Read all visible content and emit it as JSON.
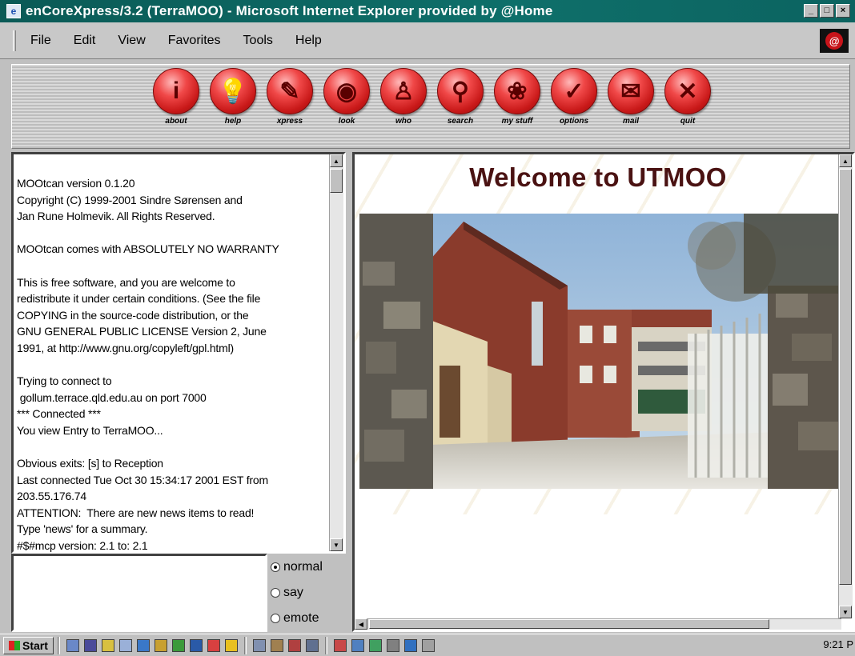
{
  "window": {
    "title": "enCoreXpress/3.2 (TerraMOO) - Microsoft Internet Explorer provided by @Home",
    "controls": [
      "_",
      "□",
      "×"
    ]
  },
  "menu": {
    "items": [
      "File",
      "Edit",
      "View",
      "Favorites",
      "Tools",
      "Help"
    ]
  },
  "toolbar": {
    "buttons": [
      {
        "label": "about",
        "icon": "info-icon",
        "glyph": "i"
      },
      {
        "label": "help",
        "icon": "lightbulb-icon",
        "glyph": "💡"
      },
      {
        "label": "xpress",
        "icon": "pencil-icon",
        "glyph": "✎"
      },
      {
        "label": "look",
        "icon": "eye-icon",
        "glyph": "◉"
      },
      {
        "label": "who",
        "icon": "person-icon",
        "glyph": "♙"
      },
      {
        "label": "search",
        "icon": "magnifier-icon",
        "glyph": "⚲"
      },
      {
        "label": "my stuff",
        "icon": "bag-icon",
        "glyph": "❀"
      },
      {
        "label": "options",
        "icon": "checkmark-icon",
        "glyph": "✓"
      },
      {
        "label": "mail",
        "icon": "envelope-icon",
        "glyph": "✉"
      },
      {
        "label": "quit",
        "icon": "close-icon",
        "glyph": "✕"
      }
    ]
  },
  "console": {
    "text": "MOOtcan version 0.1.20\nCopyright (C) 1999-2001 Sindre Sørensen and\nJan Rune Holmevik. All Rights Reserved.\n\nMOOtcan comes with ABSOLUTELY NO WARRANTY\n\nThis is free software, and you are welcome to\nredistribute it under certain conditions. (See the file\nCOPYING in the source-code distribution, or the\nGNU GENERAL PUBLIC LICENSE Version 2, June\n1991, at http://www.gnu.org/copyleft/gpl.html)\n\nTrying to connect to\n gollum.terrace.qld.edu.au on port 7000\n*** Connected ***\nYou view Entry to TerraMOO...\n\nObvious exits: [s] to Reception\nLast connected Tue Oct 30 15:34:17 2001 EST from\n203.55.176.74\nATTENTION:  There are new news items to read!\nType 'news' for a summary.\n#$#mcp version: 2.1 to: 2.1"
  },
  "modes": {
    "options": [
      "normal",
      "say",
      "emote"
    ],
    "selected": "normal"
  },
  "web": {
    "heading": "Welcome to UTMOO"
  },
  "taskbar": {
    "start_label": "Start",
    "clock": "9:21 P"
  }
}
